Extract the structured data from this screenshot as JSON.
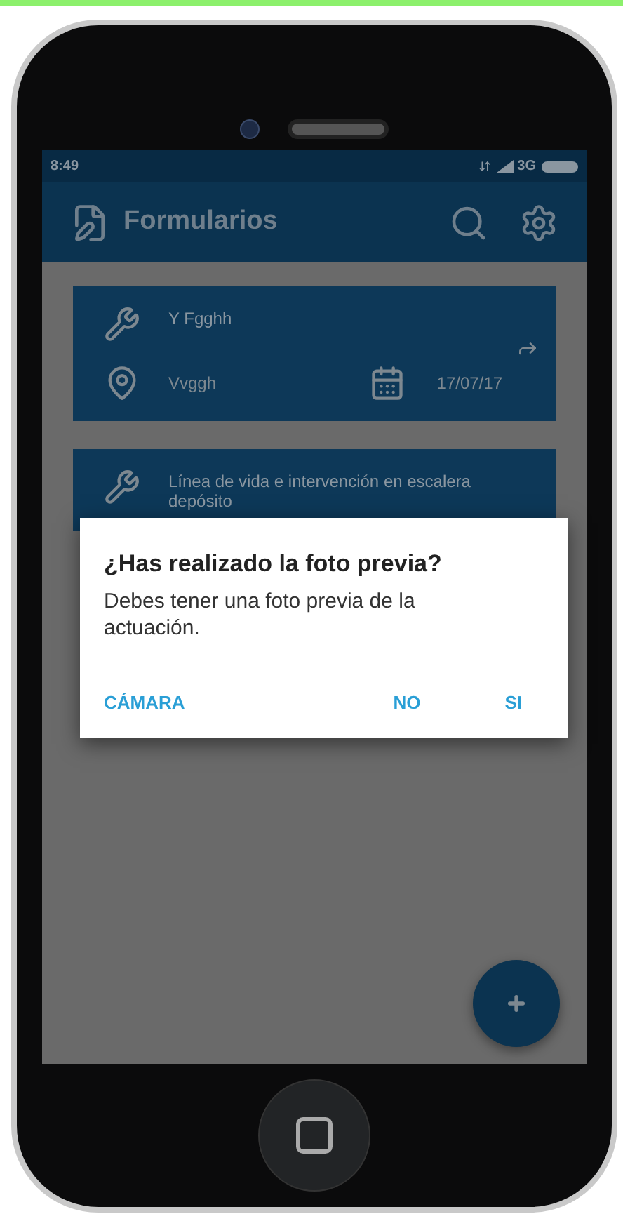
{
  "status_bar": {
    "time": "8:49",
    "network": "3G"
  },
  "app_bar": {
    "title": "Formularios"
  },
  "forms": [
    {
      "work": "Y Fgghh",
      "location": "Vvggh",
      "date": "17/07/17"
    },
    {
      "work": "Línea de vida e intervención en escalera depósito"
    }
  ],
  "dialog": {
    "title": "¿Has realizado la foto previa?",
    "message": "Debes tener una foto previa de la actuación.",
    "buttons": [
      "CÁMARA",
      "NO",
      "SI"
    ]
  }
}
